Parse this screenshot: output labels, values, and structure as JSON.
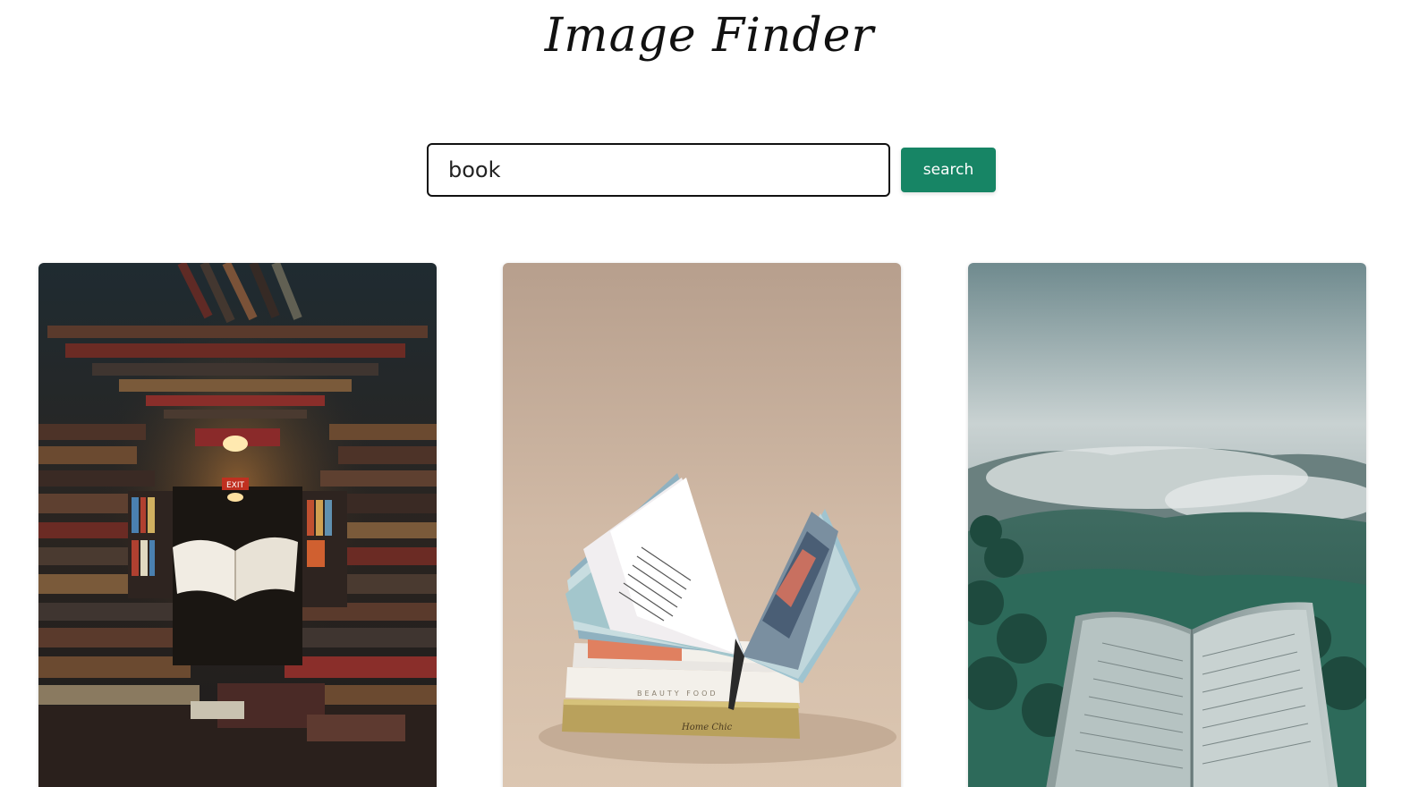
{
  "header": {
    "logo_text": "Image Finder"
  },
  "search": {
    "value": "book",
    "button_label": "search"
  },
  "colors": {
    "accent": "#178565"
  },
  "results": [
    {
      "description_icon": "library-flying-book-image"
    },
    {
      "description_icon": "open-book-stack-image"
    },
    {
      "description_icon": "misty-forest-open-book-image"
    }
  ]
}
